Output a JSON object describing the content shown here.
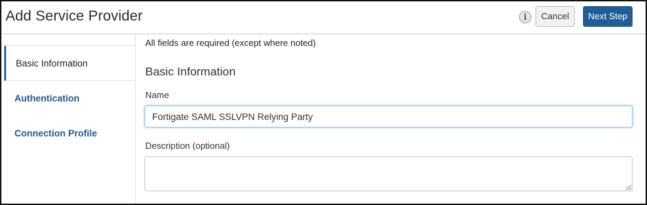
{
  "header": {
    "title": "Add Service Provider",
    "info_icon_glyph": "i",
    "cancel_label": "Cancel",
    "next_label": "Next Step"
  },
  "sidebar": {
    "items": [
      {
        "label": "Basic Information",
        "active": true
      },
      {
        "label": "Authentication",
        "active": false
      },
      {
        "label": "Connection Profile",
        "active": false
      }
    ]
  },
  "form": {
    "required_note": "All fields are required (except where noted)",
    "section_title": "Basic Information",
    "name_label": "Name",
    "name_value": "Fortigate SAML SSLVPN Relying Party",
    "description_label": "Description (optional)",
    "description_value": ""
  },
  "colors": {
    "primary_button": "#1d5f96",
    "link": "#1f5a8f",
    "focus_border": "#8fc6e8"
  }
}
